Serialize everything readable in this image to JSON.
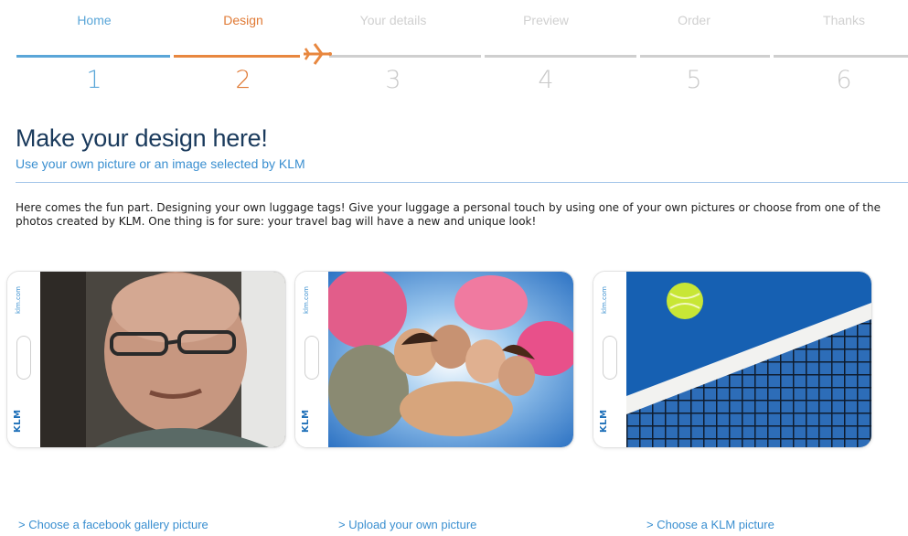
{
  "stepper": {
    "steps": [
      {
        "label": "Home",
        "number": "1"
      },
      {
        "label": "Design",
        "number": "2"
      },
      {
        "label": "Your details",
        "number": "3"
      },
      {
        "label": "Preview",
        "number": "4"
      },
      {
        "label": "Order",
        "number": "5"
      },
      {
        "label": "Thanks",
        "number": "6"
      }
    ],
    "colors": {
      "done": "#5aa6d8",
      "current": "#e07a35",
      "pending": "#c9c9c9"
    }
  },
  "main": {
    "title": "Make your design here!",
    "subtitle": "Use your own picture or an image selected by KLM",
    "intro": "Here comes the fun part. Designing your own luggage tags! Give your luggage a personal touch by using one of your own pictures or choose from one of the photos created by KLM.  One thing is for sure: your travel bag will have a new and unique look!"
  },
  "tags": [
    {
      "url": "klm.com",
      "logo": "KLM",
      "link": "> Choose a facebook gallery picture"
    },
    {
      "url": "klm.com",
      "logo": "KLM",
      "link": "> Upload your own picture"
    },
    {
      "url": "klm.com",
      "logo": "KLM",
      "link": "> Choose a KLM picture"
    }
  ]
}
